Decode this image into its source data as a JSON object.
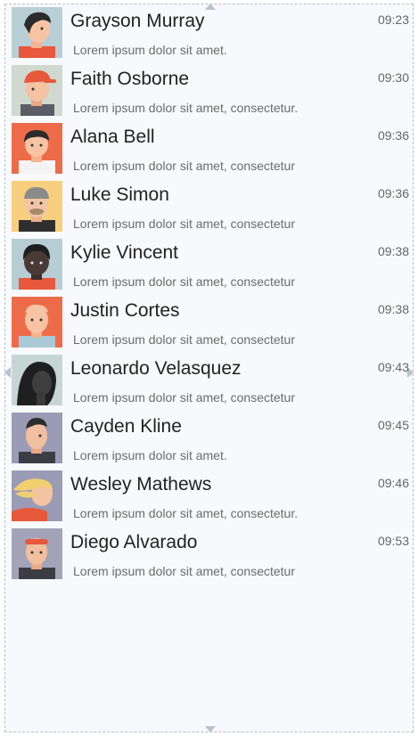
{
  "contacts": [
    {
      "name": "Grayson Murray",
      "time": "09:23",
      "message": "Lorem ipsum dolor sit amet.",
      "avatar": "avatar-grayson-murray",
      "bg": "#b9cfd6"
    },
    {
      "name": "Faith Osborne",
      "time": "09:30",
      "message": "Lorem ipsum dolor sit amet, consectetur.",
      "avatar": "avatar-faith-osborne",
      "bg": "#cfd9cf"
    },
    {
      "name": "Alana Bell",
      "time": "09:36",
      "message": "Lorem ipsum dolor sit amet, consectetur",
      "avatar": "avatar-alana-bell",
      "bg": "#ee6b49"
    },
    {
      "name": "Luke Simon",
      "time": "09:36",
      "message": "Lorem ipsum dolor sit amet, consectetur",
      "avatar": "avatar-luke-simon",
      "bg": "#f7cf7e"
    },
    {
      "name": "Kylie Vincent",
      "time": "09:38",
      "message": "Lorem ipsum dolor sit amet, consectetur",
      "avatar": "avatar-kylie-vincent",
      "bg": "#b7cdd4"
    },
    {
      "name": "Justin Cortes",
      "time": "09:38",
      "message": "Lorem ipsum dolor sit amet, consectetur",
      "avatar": "avatar-justin-cortes",
      "bg": "#ee6b49"
    },
    {
      "name": "Leonardo Velasquez",
      "time": "09:43",
      "message": "Lorem ipsum dolor sit amet, consectetur",
      "avatar": "avatar-leonardo-velasquez",
      "bg": "#c6d6d4"
    },
    {
      "name": "Cayden Kline",
      "time": "09:45",
      "message": "Lorem ipsum dolor sit amet.",
      "avatar": "avatar-cayden-kline",
      "bg": "#9a9bb5"
    },
    {
      "name": "Wesley Mathews",
      "time": "09:46",
      "message": "Lorem ipsum dolor sit amet, consectetur.",
      "avatar": "avatar-wesley-mathews",
      "bg": "#9a9bb5"
    },
    {
      "name": "Diego Alvarado",
      "time": "09:53",
      "message": "Lorem ipsum dolor sit amet, consectetur",
      "avatar": "avatar-diego-alvarado",
      "bg": "#a4a4b8"
    }
  ]
}
